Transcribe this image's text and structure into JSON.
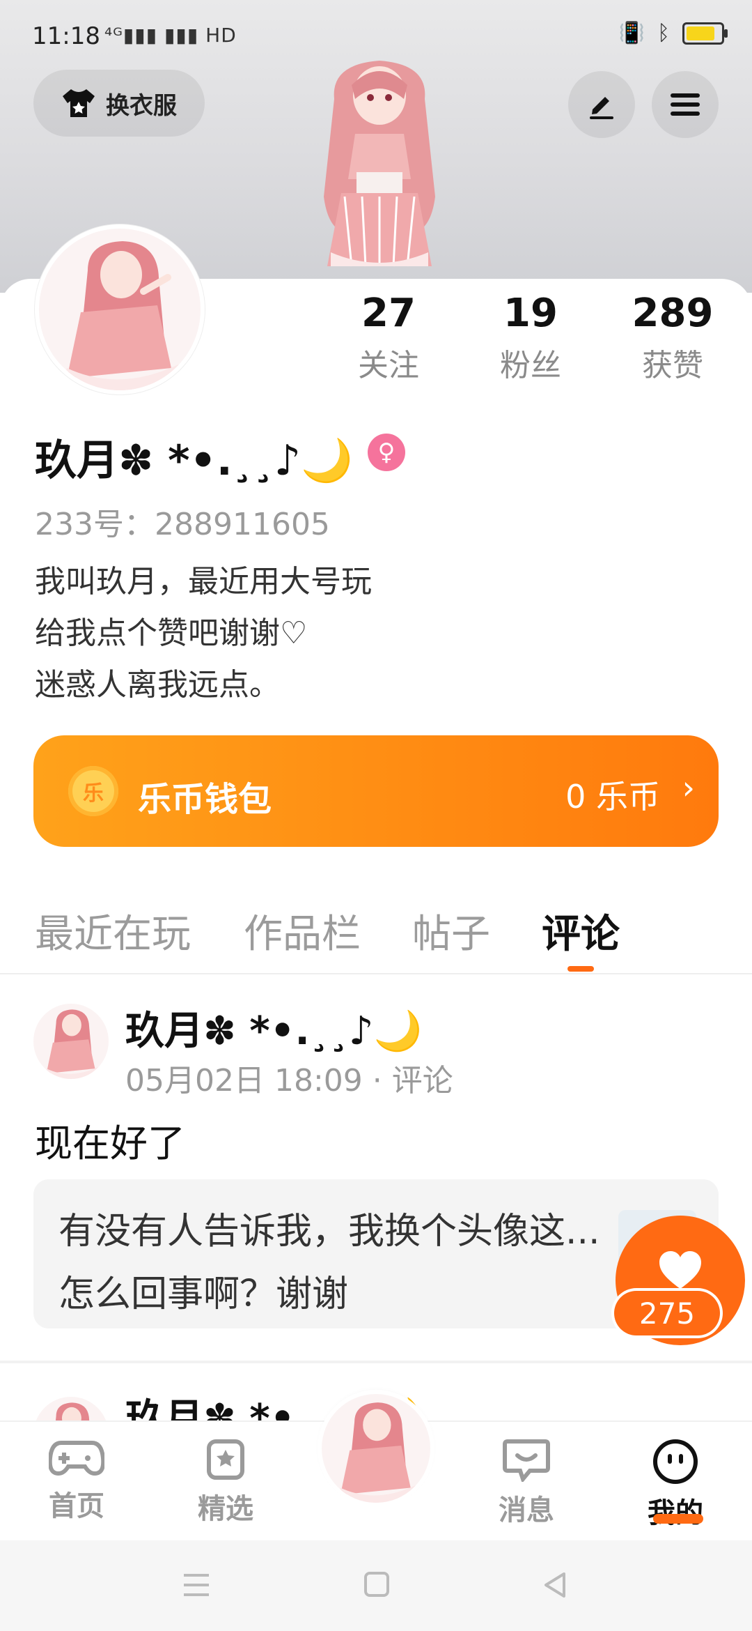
{
  "status_bar": {
    "time": "11:18",
    "network": "4G HD",
    "battery_color": "#f7d51b"
  },
  "header": {
    "change_outfit_label": "换衣服"
  },
  "stats": [
    {
      "value": "27",
      "label": "关注"
    },
    {
      "value": "19",
      "label": "粉丝"
    },
    {
      "value": "289",
      "label": "获赞"
    }
  ],
  "profile": {
    "name": "玖月✽ *•.¸¸♪🌙",
    "id_text": "233号：288911605",
    "bio": [
      "我叫玖月，最近用大号玩",
      "给我点个赞吧谢谢♡",
      "迷惑人离我远点。"
    ]
  },
  "wallet": {
    "coin_char": "乐",
    "title": "乐币钱包",
    "value": "0 乐币"
  },
  "tabs": [
    "最近在玩",
    "作品栏",
    "帖子",
    "评论"
  ],
  "active_tab": "评论",
  "comment": {
    "author": "玖月✽ *•.¸¸♪🌙",
    "meta": "05月02日 18:09 · 评论",
    "text": "现在好了",
    "quote": "有没有人告诉我，我换个头像这...怎么回事啊？谢谢",
    "likes": "275"
  },
  "next_comment_author": "玖月✽ *•.¸¸♪🌙",
  "nav": [
    {
      "label": "首页",
      "icon": "gamepad-icon"
    },
    {
      "label": "精选",
      "icon": "star-bookmark-icon"
    },
    {
      "label": "",
      "icon": "avatar"
    },
    {
      "label": "消息",
      "icon": "chat-icon"
    },
    {
      "label": "我的",
      "icon": "face-icon"
    }
  ],
  "accent_color": "#ff6a13"
}
